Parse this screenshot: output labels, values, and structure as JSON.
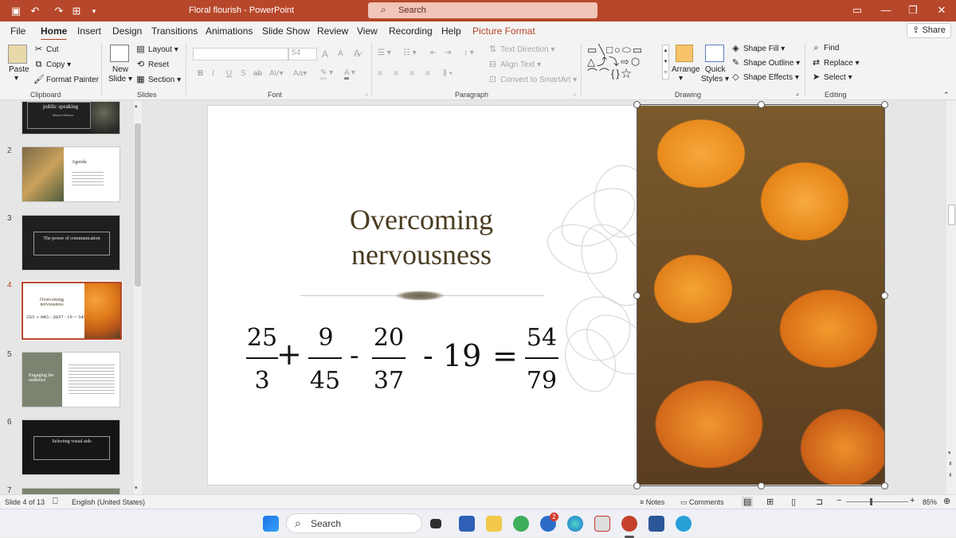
{
  "titlebar": {
    "filename": "Floral flourish",
    "separator": " - ",
    "app": "PowerPoint",
    "search_placeholder": "Search"
  },
  "menu": {
    "tabs": [
      "File",
      "Home",
      "Insert",
      "Design",
      "Transitions",
      "Animations",
      "Slide Show",
      "Review",
      "View",
      "Recording",
      "Help",
      "Picture Format"
    ],
    "active": "Home",
    "share": "Share"
  },
  "ribbon": {
    "clipboard": {
      "paste": "Paste",
      "cut": "Cut",
      "copy": "Copy",
      "format_painter": "Format Painter",
      "label": "Clipboard"
    },
    "slides": {
      "new_slide": "New",
      "new_slide2": "Slide",
      "layout": "Layout",
      "reset": "Reset",
      "section": "Section",
      "label": "Slides"
    },
    "font": {
      "size": "54",
      "label": "Font",
      "bold": "B",
      "italic": "I",
      "underline": "U",
      "shadow": "S",
      "strike": "ab",
      "spacing": "AV",
      "case": "Aa",
      "grow": "A",
      "shrink": "A"
    },
    "paragraph": {
      "text_direction": "Text Direction",
      "align_text": "Align Text",
      "convert": "Convert to SmartArt",
      "label": "Paragraph"
    },
    "drawing": {
      "arrange": "Arrange",
      "quick": "Quick",
      "styles": "Styles",
      "shape_fill": "Shape Fill",
      "shape_outline": "Shape Outline",
      "shape_effects": "Shape Effects",
      "label": "Drawing"
    },
    "editing": {
      "find": "Find",
      "replace": "Replace",
      "select": "Select",
      "label": "Editing"
    }
  },
  "thumbnails": [
    {
      "num": "",
      "title": "public speaking",
      "sub": "Mirjam Nilsson",
      "dark": true
    },
    {
      "num": "2",
      "title": "Agenda",
      "dark": false
    },
    {
      "num": "3",
      "title": "The power of communication",
      "dark": true
    },
    {
      "num": "4",
      "title": "Overcoming nervousness",
      "dark": false,
      "selected": true
    },
    {
      "num": "5",
      "title": "Engaging the audience",
      "dark": false
    },
    {
      "num": "6",
      "title": "Selecting visual aids",
      "dark": true
    },
    {
      "num": "7",
      "title": "",
      "dark": false
    }
  ],
  "slide": {
    "title_line1": "Overcoming",
    "title_line2": "nervousness",
    "equation": {
      "f1_num": "25",
      "f1_den": "3",
      "plus": "+",
      "f2_num": "9",
      "f2_den": "45",
      "minus1": "-",
      "f3_num": "20",
      "f3_den": "37",
      "minus2": "- 19",
      "equals": "=",
      "f4_num": "54",
      "f4_den": "79"
    }
  },
  "status": {
    "slide_info": "Slide 4 of 13",
    "language": "English (United States)",
    "notes": "Notes",
    "comments": "Comments",
    "zoom": "85%"
  },
  "taskbar": {
    "search": "Search",
    "badge": "2"
  },
  "colors": {
    "accent": "#b7472a",
    "flower": "#e8891c",
    "title": "#4a3c22"
  }
}
